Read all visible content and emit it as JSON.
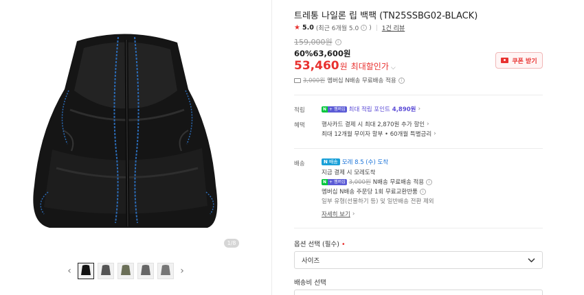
{
  "gallery": {
    "counter": "1/8",
    "prev_icon": "chevron-left-icon",
    "next_icon": "chevron-right-icon",
    "thumb_count": 5
  },
  "product": {
    "title": "트레통 나일론 립 백팩 (TN25SSBG02-BLACK)",
    "rating_score": "5.0",
    "rating_recent": "(최근 6개월 5.0",
    "rating_recent_close": ")",
    "review_count": "1건 리뷰",
    "original_price": "159,000원",
    "sale_percent": "60%",
    "sale_price": "63,600원",
    "max_price": "53,460",
    "max_unit": "원",
    "max_label": "최대할인가",
    "coupon_label": "쿠폰 받기",
    "ship_strike": "3,000원",
    "ship_text": "멤버십 N배송 무료배송 적용"
  },
  "benefits": {
    "points_label": "적립",
    "points_badge_n": "N",
    "points_badge_plus": "+",
    "points_badge_mem": "멤버십",
    "points_text": "최대 적립 포인트",
    "points_value": "4,890원",
    "benefit_label": "혜택",
    "benefit_line1": "행사카드 결제 시 최대 2,870원 추가 할인",
    "benefit_line2": "최대 12개월 무이자 할부 • 60개월 특별금리"
  },
  "shipping": {
    "label": "배송",
    "badge_n": "N",
    "badge_text": "배송",
    "arrival": "모레 8.5 (수) 도착",
    "line1": "지금 결제 시 모레도착",
    "line2_strike": "3,000원",
    "line2_text": "N배송 무료배송 적용",
    "line3": "멤버십 N배송 주문당 1회 무료교환반품",
    "line4": "일부 유형(선물하기 등) 및 일반배송 전환 제외",
    "more": "자세히 보기"
  },
  "options": {
    "label": "옵션 선택",
    "required": "(필수)",
    "required_mark": "•",
    "select_value": "사이즈",
    "ship_fee_label": "배송비 선택"
  },
  "colors": {
    "accent_red": "#e8312f",
    "naver_green": "#00c73c",
    "membership_purple": "#5b4bd6"
  }
}
